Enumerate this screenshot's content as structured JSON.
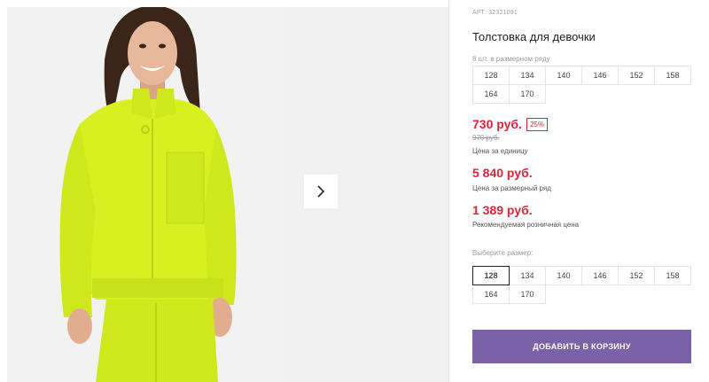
{
  "product": {
    "article_label": "АРТ:",
    "article_number": "32321091",
    "title": "Толстовка для девочки",
    "row_info": "8 шт. в размерном ряду",
    "row_sizes": [
      "128",
      "134",
      "140",
      "146",
      "152",
      "158",
      "164",
      "170"
    ]
  },
  "pricing": {
    "unit_price": "730 руб.",
    "discount": "25%",
    "old_price": "970 руб.",
    "unit_caption": "Цена за единицу",
    "row_price": "5 840 руб.",
    "row_caption": "Цена за размерный ряд",
    "retail_price": "1 389 руб.",
    "retail_caption": "Рекомендуемая розничная цена"
  },
  "size_select": {
    "label": "Выберите размер:",
    "options": [
      "128",
      "134",
      "140",
      "146",
      "152",
      "158",
      "164",
      "170"
    ],
    "selected": "128"
  },
  "cart": {
    "button_label": "ДОБАВИТЬ В КОРЗИНУ"
  },
  "colors": {
    "accent": "#7b61a8",
    "price": "#e3223a",
    "garment": "#d8f020"
  },
  "icons": {
    "gallery_next": "chevron-right-icon"
  }
}
